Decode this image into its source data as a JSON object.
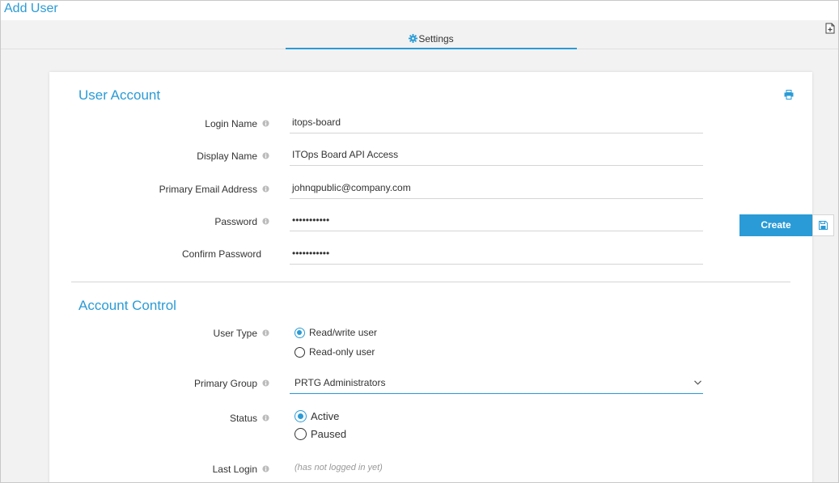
{
  "header": {
    "title": "Add User"
  },
  "tabs": [
    {
      "label": "Settings",
      "active": true
    }
  ],
  "user_account": {
    "title": "User Account",
    "fields": [
      {
        "label": "Login Name",
        "value": "itops-board",
        "info": true
      },
      {
        "label": "Display Name",
        "value": "ITOps Board API Access",
        "info": true
      },
      {
        "label": "Primary Email Address",
        "value": "johnqpublic@company.com",
        "info": true
      },
      {
        "label": "Password",
        "value": "•••••••••••",
        "info": true
      },
      {
        "label": "Confirm Password",
        "value": "•••••••••••",
        "info": false
      }
    ]
  },
  "account_control": {
    "title": "Account Control",
    "user_type": {
      "label": "User Type",
      "options": [
        "Read/write user",
        "Read-only user"
      ],
      "selected": "Read/write user"
    },
    "primary_group": {
      "label": "Primary Group",
      "value": "PRTG Administrators"
    },
    "status": {
      "label": "Status",
      "options": [
        "Active",
        "Paused"
      ],
      "selected": "Active"
    },
    "last_login": {
      "label": "Last Login",
      "value": "(has not logged in yet)"
    }
  },
  "actions": {
    "create_label": "Create"
  },
  "colors": {
    "accent": "#2a9bd6",
    "background": "#f2f2f2",
    "card": "#ffffff"
  },
  "icons": [
    "gear-icon",
    "print-icon",
    "info-icon",
    "chevron-down-icon",
    "save-icon",
    "document-icon"
  ]
}
